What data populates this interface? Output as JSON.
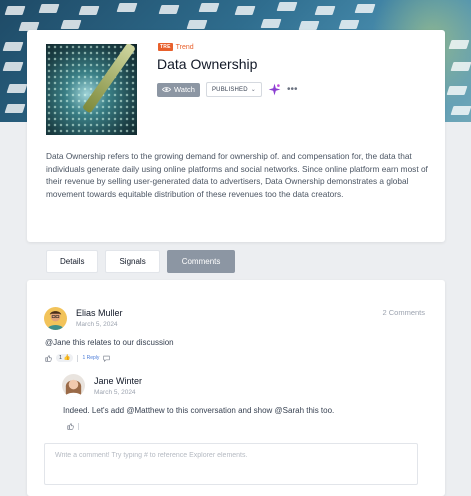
{
  "entity": {
    "type_badge": "TRE",
    "type_label": "Trend",
    "title": "Data Ownership",
    "watch_label": "Watch",
    "status": "PUBLISHED",
    "description": "Data Ownership refers to the growing demand for ownership of. and compensation for, the data that individuals generate daily using online platforms and social networks. Since online platform earn most of their revenue by selling user-generated data to advertisers, Data Ownership demonstrates a global movement towards equitable distribution of these revenues too the data creators.",
    "accent_color": "#e8602c"
  },
  "tabs": [
    {
      "label": "Details",
      "active": false
    },
    {
      "label": "Signals",
      "active": false
    },
    {
      "label": "Comments",
      "active": true
    }
  ],
  "comments": {
    "count_label": "2 Comments",
    "items": [
      {
        "author": "Elias Muller",
        "date": "March 5, 2024",
        "text": "@Jane this relates to our discussion",
        "likes": "1 👍",
        "reply_label": "1 Reply"
      }
    ],
    "reply": {
      "author": "Jane Winter",
      "date": "March 5, 2024",
      "text": "Indeed. Let's add @Matthew to this conversation and show @Sarah this too."
    },
    "input_placeholder": "Write a comment! Try typing # to reference Explorer elements."
  }
}
